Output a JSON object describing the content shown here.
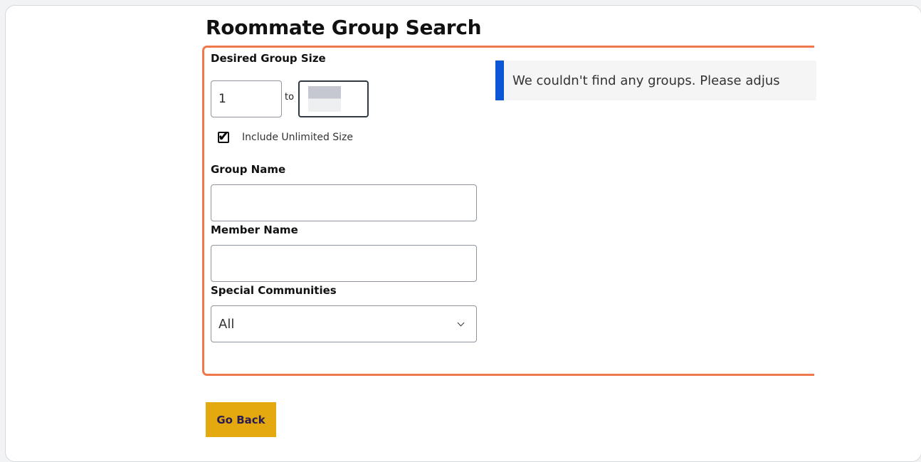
{
  "page": {
    "title": "Roommate Group Search"
  },
  "filters": {
    "group_size": {
      "label": "Desired Group Size",
      "min_value": "1",
      "to_label": "to",
      "include_unlimited_label": "Include Unlimited Size",
      "include_unlimited_checked": true
    },
    "group_name": {
      "label": "Group Name",
      "value": ""
    },
    "member_name": {
      "label": "Member Name",
      "value": ""
    },
    "special_communities": {
      "label": "Special Communities",
      "selected": "All"
    }
  },
  "results": {
    "message": "We couldn't find any groups. Please adjus"
  },
  "actions": {
    "go_back_label": "Go Back"
  },
  "colors": {
    "panel_border": "#f0784a",
    "notice_accent": "#0b56d4",
    "go_back_button": "#e3a90e",
    "go_back_text": "#2a1b52"
  }
}
